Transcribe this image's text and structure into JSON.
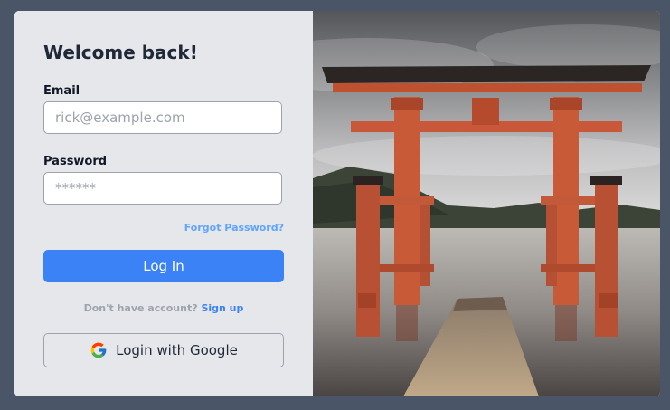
{
  "login": {
    "title": "Welcome back!",
    "email_label": "Email",
    "email_placeholder": "rick@example.com",
    "password_label": "Password",
    "password_placeholder": "******",
    "forgot_label": "Forgot Password?",
    "login_label": "Log In",
    "signup_prompt": "Don't have account?",
    "signup_link": "Sign up",
    "google_label": "Login with Google"
  },
  "colors": {
    "page_background": "#4b5568",
    "card_background": "#e5e7eb",
    "accent": "#3b82f6",
    "link": "#60a5fa"
  },
  "icons": {
    "google": "google-icon"
  },
  "image": {
    "subject": "torii-gate-photo"
  }
}
